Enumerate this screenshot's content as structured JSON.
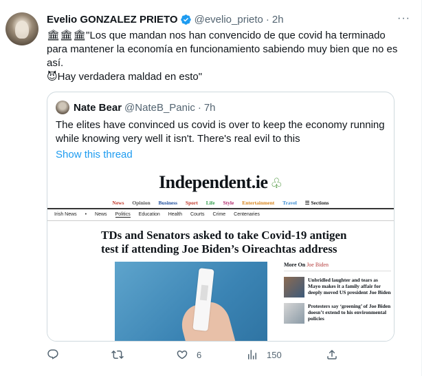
{
  "tweet": {
    "author_name": "Evelio GONZALEZ PRIETO",
    "handle": "@evelio_prieto",
    "separator": "·",
    "time": "2h",
    "more": "···",
    "line1": "🏛🏛🏛\"Los que mandan nos han convencido de que covid ha terminado para mantener la economía en funcionamiento sabiendo muy bien que no es así.",
    "line2": "😈Hay verdadera maldad en esto\""
  },
  "quote": {
    "author_name": "Nate Bear",
    "handle": "@NateB_Panic",
    "separator": "·",
    "time": "7h",
    "text": "The elites have convinced us covid is over to keep the economy running while knowing very well it isn't. There's real evil to this",
    "link": "Show this thread",
    "article": {
      "logo": "Independent.ie",
      "nav": [
        "News",
        "Opinion",
        "Business",
        "Sport",
        "Life",
        "Style",
        "Entertainment",
        "Travel",
        "☰ Sections"
      ],
      "subnav": [
        "Irish News",
        "•",
        "News",
        "Politics",
        "Education",
        "Health",
        "Courts",
        "Crime",
        "Centenaries"
      ],
      "headline": "TDs and Senators asked to take Covid-19 antigen test if attending Joe Biden’s Oireachtas address",
      "more_on_label": "More On",
      "more_on_topic": "Joe Biden",
      "side_items": [
        "Unbridled laughter and tears as Mayo makes it a family affair for deeply moved US president Joe Biden",
        "Protesters say ‘greening’ of Joe Biden doesn’t extend to his environmental policies"
      ]
    }
  },
  "actions": {
    "reply_count": "",
    "retweet_count": "",
    "like_count": "6",
    "views_count": "150"
  },
  "colors": {
    "link": "#1d9bf0",
    "muted": "#536471",
    "verified": "#1d9bf0"
  }
}
